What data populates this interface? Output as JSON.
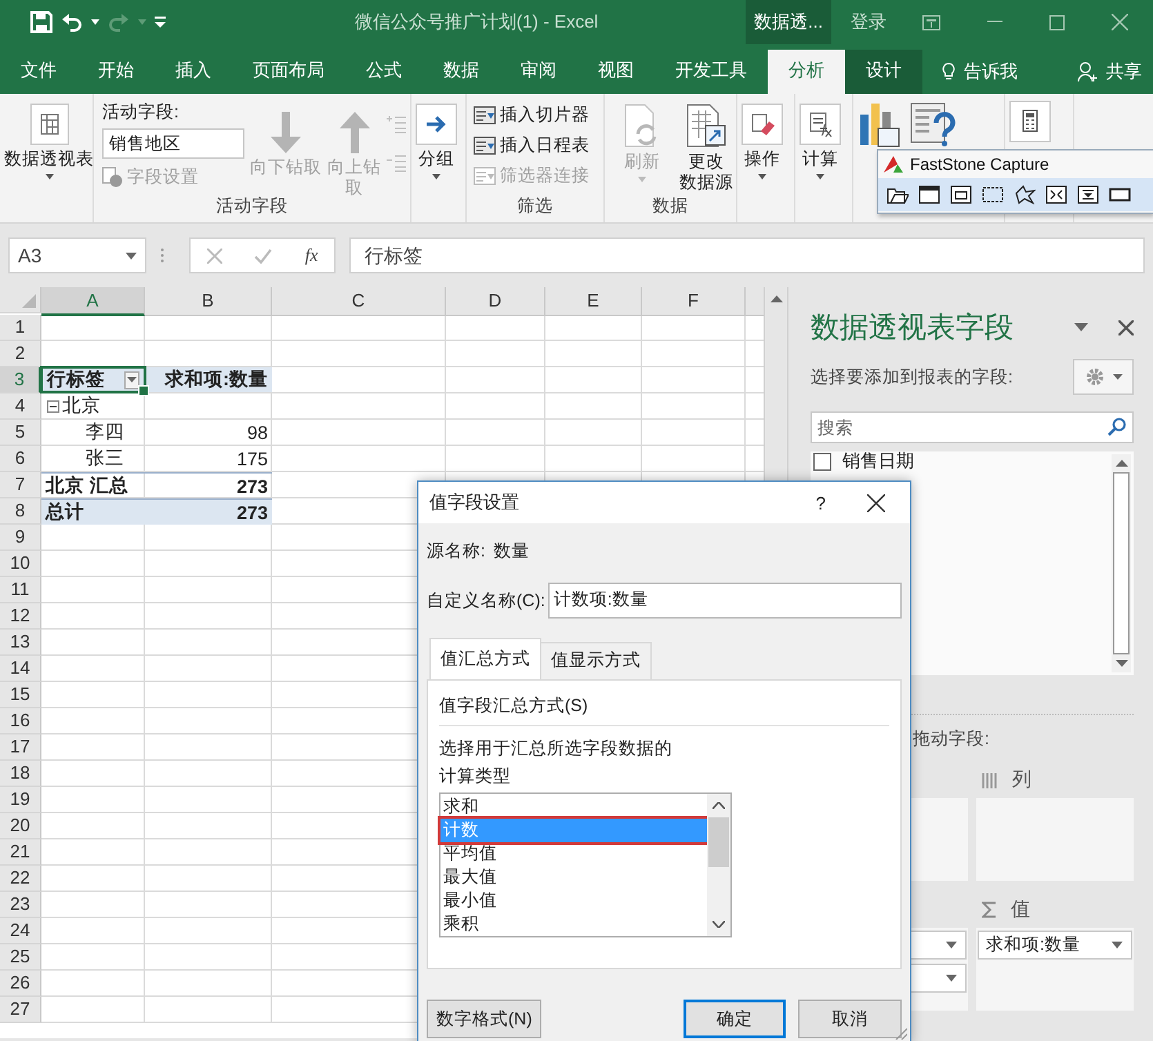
{
  "title_bar": {
    "title": "微信公众号推广计划(1) - Excel",
    "context_tab": "数据透...",
    "sign_in": "登录"
  },
  "tabs": [
    {
      "label": "文件",
      "selected": false,
      "kind": "main"
    },
    {
      "label": "开始",
      "selected": false,
      "kind": "main"
    },
    {
      "label": "插入",
      "selected": false,
      "kind": "main"
    },
    {
      "label": "页面布局",
      "selected": false,
      "kind": "main"
    },
    {
      "label": "公式",
      "selected": false,
      "kind": "main"
    },
    {
      "label": "数据",
      "selected": false,
      "kind": "main"
    },
    {
      "label": "审阅",
      "selected": false,
      "kind": "main"
    },
    {
      "label": "视图",
      "selected": false,
      "kind": "main"
    },
    {
      "label": "开发工具",
      "selected": false,
      "kind": "main"
    },
    {
      "label": "分析",
      "selected": true,
      "kind": "context"
    },
    {
      "label": "设计",
      "selected": false,
      "kind": "context"
    }
  ],
  "tell_me": "告诉我",
  "share": "共享",
  "ribbon": {
    "pivot_table": {
      "label": "数据透视表"
    },
    "active_field": {
      "label": "活动字段:",
      "value": "销售地区",
      "field_settings": {
        "label": "字段设置",
        "disabled": true
      },
      "drill_down": {
        "label": "向下钻取",
        "disabled": true
      },
      "drill_up": {
        "label_lines": [
          "向上钻",
          "取"
        ],
        "disabled": true
      },
      "group_title": "活动字段"
    },
    "group": {
      "label": "分组"
    },
    "filter": {
      "items": [
        {
          "label": "插入切片器",
          "disabled": false
        },
        {
          "label": "插入日程表",
          "disabled": false
        },
        {
          "label": "筛选器连接",
          "disabled": true
        }
      ],
      "group_title": "筛选"
    },
    "data": {
      "refresh": {
        "label": "刷新",
        "disabled": true
      },
      "change_source": {
        "label_lines": [
          "更改",
          "数据源"
        ],
        "disabled": false
      },
      "group_title": "数据"
    },
    "actions": {
      "label": "操作"
    },
    "calculations": {
      "label": "计算"
    }
  },
  "capture_toolbar": {
    "title": "FastStone Capture"
  },
  "formula_bar": {
    "name_box": "A3",
    "function_label": "fx",
    "formula": "行标签"
  },
  "sheet": {
    "columns": [
      {
        "label": "A",
        "selected": true
      },
      {
        "label": "B",
        "selected": false
      },
      {
        "label": "C",
        "selected": false
      },
      {
        "label": "D",
        "selected": false
      },
      {
        "label": "E",
        "selected": false
      },
      {
        "label": "F",
        "selected": false
      }
    ],
    "rows": [
      {
        "number": "1",
        "selected": false
      },
      {
        "number": "2",
        "selected": false
      },
      {
        "number": "3",
        "selected": true,
        "kind": "header",
        "a": "行标签",
        "b": "求和项:数量"
      },
      {
        "number": "4",
        "selected": false,
        "kind": "group",
        "a": "北京"
      },
      {
        "number": "5",
        "selected": false,
        "kind": "item",
        "a": "李四",
        "b": "98"
      },
      {
        "number": "6",
        "selected": false,
        "kind": "item",
        "a": "张三",
        "b": "175"
      },
      {
        "number": "7",
        "selected": false,
        "kind": "subtotal",
        "a": "北京 汇总",
        "b": "273"
      },
      {
        "number": "8",
        "selected": false,
        "kind": "total",
        "a": "总计",
        "b": "273"
      },
      {
        "number": "9",
        "selected": false
      },
      {
        "number": "10",
        "selected": false
      },
      {
        "number": "11",
        "selected": false
      },
      {
        "number": "12",
        "selected": false
      },
      {
        "number": "13",
        "selected": false
      },
      {
        "number": "14",
        "selected": false
      },
      {
        "number": "15",
        "selected": false
      },
      {
        "number": "16",
        "selected": false
      },
      {
        "number": "17",
        "selected": false
      },
      {
        "number": "18",
        "selected": false
      },
      {
        "number": "19",
        "selected": false
      },
      {
        "number": "20",
        "selected": false
      },
      {
        "number": "21",
        "selected": false
      },
      {
        "number": "22",
        "selected": false
      },
      {
        "number": "23",
        "selected": false
      },
      {
        "number": "24",
        "selected": false
      },
      {
        "number": "25",
        "selected": false
      },
      {
        "number": "26",
        "selected": false
      },
      {
        "number": "27",
        "selected": false
      }
    ]
  },
  "field_pane": {
    "title": "数据透视表字段",
    "prompt": "选择要添加到报表的字段:",
    "search_placeholder": "搜索",
    "fields": [
      {
        "label": "销售日期",
        "checked": false
      }
    ],
    "drag_prompt": "拖动字段:",
    "columns_area": {
      "label": "列"
    },
    "values_area": {
      "label": "值",
      "items": [
        "求和项:数量"
      ]
    }
  },
  "dialog": {
    "title": "值字段设置",
    "help": "?",
    "source_label": "源名称:",
    "source_value": "数量",
    "custom_name_label": "自定义名称(C):",
    "custom_name_value": "计数项:数量",
    "tabs": [
      {
        "label": "值汇总方式",
        "selected": true
      },
      {
        "label": "值显示方式",
        "selected": false
      }
    ],
    "section_title": "值字段汇总方式(S)",
    "description_lines": [
      "选择用于汇总所选字段数据的",
      "计算类型"
    ],
    "functions": [
      {
        "label": "求和",
        "selected": false
      },
      {
        "label": "计数",
        "selected": true
      },
      {
        "label": "平均值",
        "selected": false
      },
      {
        "label": "最大值",
        "selected": false
      },
      {
        "label": "最小值",
        "selected": false
      },
      {
        "label": "乘积",
        "selected": false
      }
    ],
    "buttons": [
      {
        "label": "数字格式(N)",
        "default": false
      },
      {
        "label": "确定",
        "default": true
      },
      {
        "label": "取消",
        "default": false
      }
    ]
  }
}
